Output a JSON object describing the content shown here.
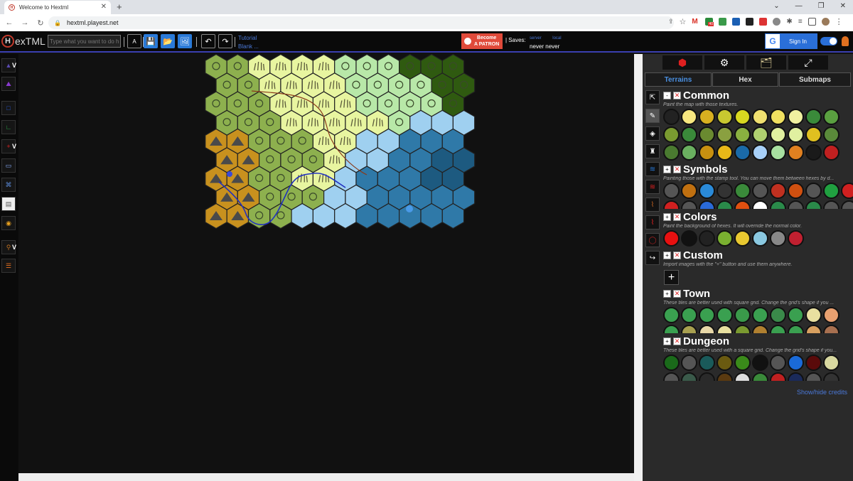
{
  "browser": {
    "tab_title": "Welcome to Hextml",
    "url": "hextml.playest.net",
    "new_tab": "+",
    "window_controls": [
      "⌄",
      "—",
      "❐",
      "✕"
    ],
    "ext_badge": "40"
  },
  "toolbar": {
    "logo_prefix": "H",
    "logo_text": "exTML",
    "search_placeholder": "Type what you want to do h",
    "translate_label": "A",
    "tutorial_label": "Tutorial",
    "blank_label": "Blank ...",
    "patron_line1": "Become",
    "patron_line2": "A PATRON",
    "saves_label": "| Saves:",
    "saves_server_small": "server",
    "saves_local_small": "local",
    "saves_server": "never",
    "saves_local": "never",
    "signin_label": "Sign In",
    "google_letter": "G"
  },
  "left_tools": {
    "v1": "V",
    "v2": "V",
    "v3": "V"
  },
  "panel": {
    "tabs": [
      "Terrains",
      "Hex",
      "Submaps"
    ],
    "sections": {
      "common": {
        "title": "Common",
        "desc": "Paint the map with those textures.",
        "toggle": "-"
      },
      "symbols": {
        "title": "Symbols",
        "desc": "Painting those with the stamp tool. You can move them between hexes by d...",
        "toggle": "+"
      },
      "colors": {
        "title": "Colors",
        "desc": "Paint the background of hexes. It will override the normal color.",
        "toggle": "+"
      },
      "custom": {
        "title": "Custom",
        "desc": "Import images with the \"+\" button and use them anywhere.",
        "toggle": "+",
        "add": "+"
      },
      "town": {
        "title": "Town",
        "desc": "These tiles are better used with square grid. Change the grid's shape if you ...",
        "toggle": "+"
      },
      "dungeon": {
        "title": "Dungeon",
        "desc": "These tiles are better used with a square grid. Change the grid's shape if you...",
        "toggle": "+"
      }
    },
    "credits": "Show/hide credits",
    "common_row1_first": "Ø",
    "common_row3_last": "X",
    "colors_none": "Ø"
  },
  "map": {
    "cols": 12,
    "rows": 9,
    "terrain_colors": {
      "g": "#8db04e",
      "p": "#e8f5a0",
      "l": "#b8e8a8",
      "b": "#9fd0f0",
      "m": "#2f79a8",
      "d": "#1d5a80",
      "h": "#c8911e",
      "f": "#2f5a10"
    },
    "grid": [
      "ggpppplllfff",
      "ggppppllllff",
      "gggppppllllff",
      "gggppppplbbb",
      "hhgggppbbmmm",
      "hhgggpbbmmdd",
      "hhggppbmmmdd",
      "hhgggbbmmmmm",
      "hhggbbbmmmmm"
    ]
  }
}
